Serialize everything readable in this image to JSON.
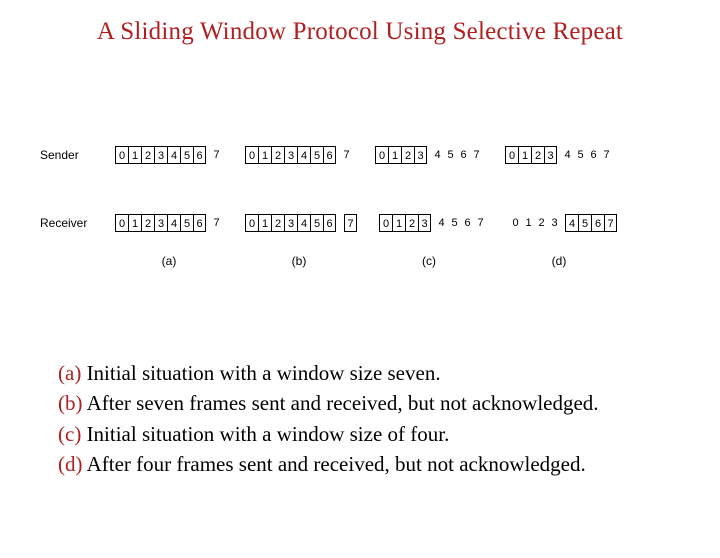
{
  "title": "A Sliding Window Protocol Using Selective Repeat",
  "rows": {
    "sender": "Sender",
    "receiver": "Receiver"
  },
  "scenarios": [
    {
      "id": "a",
      "caption": "(a)",
      "sender": {
        "boxed": [
          "0",
          "1",
          "2",
          "3",
          "4",
          "5",
          "6"
        ],
        "after": [
          "7"
        ],
        "boxed2": []
      },
      "receiver": {
        "boxed": [
          "0",
          "1",
          "2",
          "3",
          "4",
          "5",
          "6"
        ],
        "after": [
          "7"
        ],
        "boxed2": []
      }
    },
    {
      "id": "b",
      "caption": "(b)",
      "sender": {
        "boxed": [
          "0",
          "1",
          "2",
          "3",
          "4",
          "5",
          "6"
        ],
        "after": [
          "7"
        ],
        "boxed2": []
      },
      "receiver": {
        "boxed": [
          "0",
          "1",
          "2",
          "3",
          "4",
          "5",
          "6"
        ],
        "after": [],
        "boxed2": [
          "7"
        ]
      }
    },
    {
      "id": "c",
      "caption": "(c)",
      "sender": {
        "boxed": [
          "0",
          "1",
          "2",
          "3"
        ],
        "after": [
          "4",
          "5",
          "6",
          "7"
        ],
        "boxed2": []
      },
      "receiver": {
        "boxed": [
          "0",
          "1",
          "2",
          "3"
        ],
        "after": [
          "4",
          "5",
          "6",
          "7"
        ],
        "boxed2": []
      }
    },
    {
      "id": "d",
      "caption": "(d)",
      "sender": {
        "boxed": [
          "0",
          "1",
          "2",
          "3"
        ],
        "after": [
          "4",
          "5",
          "6",
          "7"
        ],
        "boxed2": []
      },
      "receiver": {
        "boxed": [],
        "after": [
          "0",
          "1",
          "2",
          "3"
        ],
        "boxed2": [
          "4",
          "5",
          "6",
          "7"
        ]
      }
    }
  ],
  "legend": [
    {
      "key": "(a)",
      "text": " Initial situation with a window size seven."
    },
    {
      "key": "(b)",
      "text": " After seven frames sent and received, but not acknowledged."
    },
    {
      "key": "(c)",
      "text": " Initial situation with a window size of four."
    },
    {
      "key": "(d)",
      "text": " After four frames sent and received, but not acknowledged."
    }
  ]
}
